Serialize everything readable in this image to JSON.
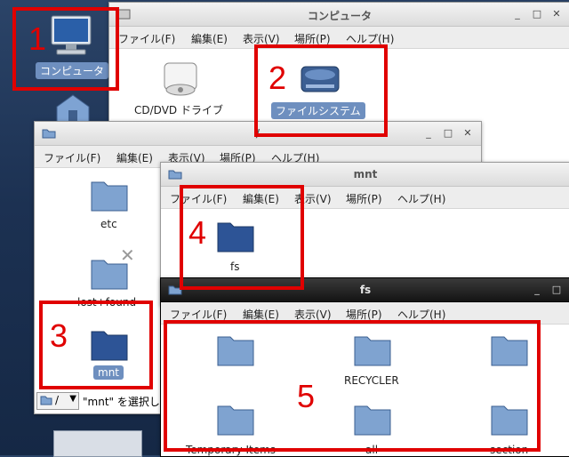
{
  "desktop": {
    "computer_label": "コンピュータ"
  },
  "menu": {
    "file": "ファイル(F)",
    "edit": "編集(E)",
    "view": "表示(V)",
    "places": "場所(P)",
    "help": "ヘルプ(H)"
  },
  "win_computer": {
    "title": "コンピュータ",
    "items": [
      "CD/DVD ドライブ",
      "ファイルシステム"
    ]
  },
  "win_root": {
    "title": "/",
    "items": [
      "etc",
      "lost+found",
      "mnt"
    ],
    "status_path": "/",
    "status_text": "\"mnt\" を選択し"
  },
  "win_mnt": {
    "title": "mnt",
    "items": [
      "fs"
    ]
  },
  "win_fs": {
    "title": "fs",
    "items": [
      "",
      "RECYCLER",
      "",
      "Temporary Items",
      "all",
      "section"
    ]
  },
  "annotations": [
    "1",
    "2",
    "3",
    "4",
    "5"
  ],
  "colors": {
    "annotation": "#e00000",
    "selection": "#6e8fbf"
  }
}
